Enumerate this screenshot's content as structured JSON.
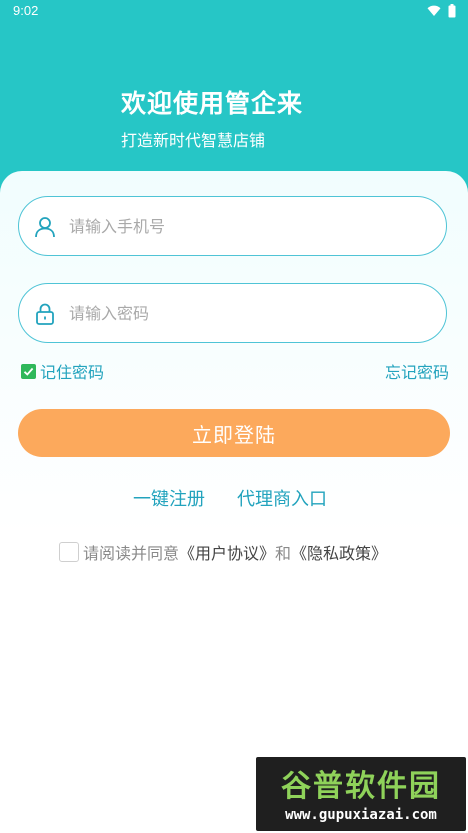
{
  "status_bar": {
    "time": "9:02"
  },
  "header": {
    "title": "欢迎使用管企来",
    "subtitle": "打造新时代智慧店铺"
  },
  "form": {
    "phone_placeholder": "请输入手机号",
    "password_placeholder": "请输入密码",
    "remember_label": "记住密码",
    "remember_checked": true,
    "forgot_label": "忘记密码",
    "login_label": "立即登陆"
  },
  "links": {
    "register": "一键注册",
    "agent_entry": "代理商入口"
  },
  "agreement": {
    "checked": false,
    "prefix": "请阅读并同意",
    "user_agreement": "《用户协议》",
    "and": "和",
    "privacy_policy": "《隐私政策》"
  },
  "watermark": {
    "title": "谷普软件园",
    "url": "www.gupuxiazai.com"
  },
  "colors": {
    "header": "#26c6c6",
    "accent_text": "#22a3bd",
    "login_button": "#fca95c",
    "input_border": "#4fc4d6",
    "checkbox_checked": "#2fb85a"
  },
  "icons": {
    "phone_field": "user-icon",
    "password_field": "lock-icon",
    "status": [
      "wifi-icon",
      "battery-icon"
    ]
  }
}
